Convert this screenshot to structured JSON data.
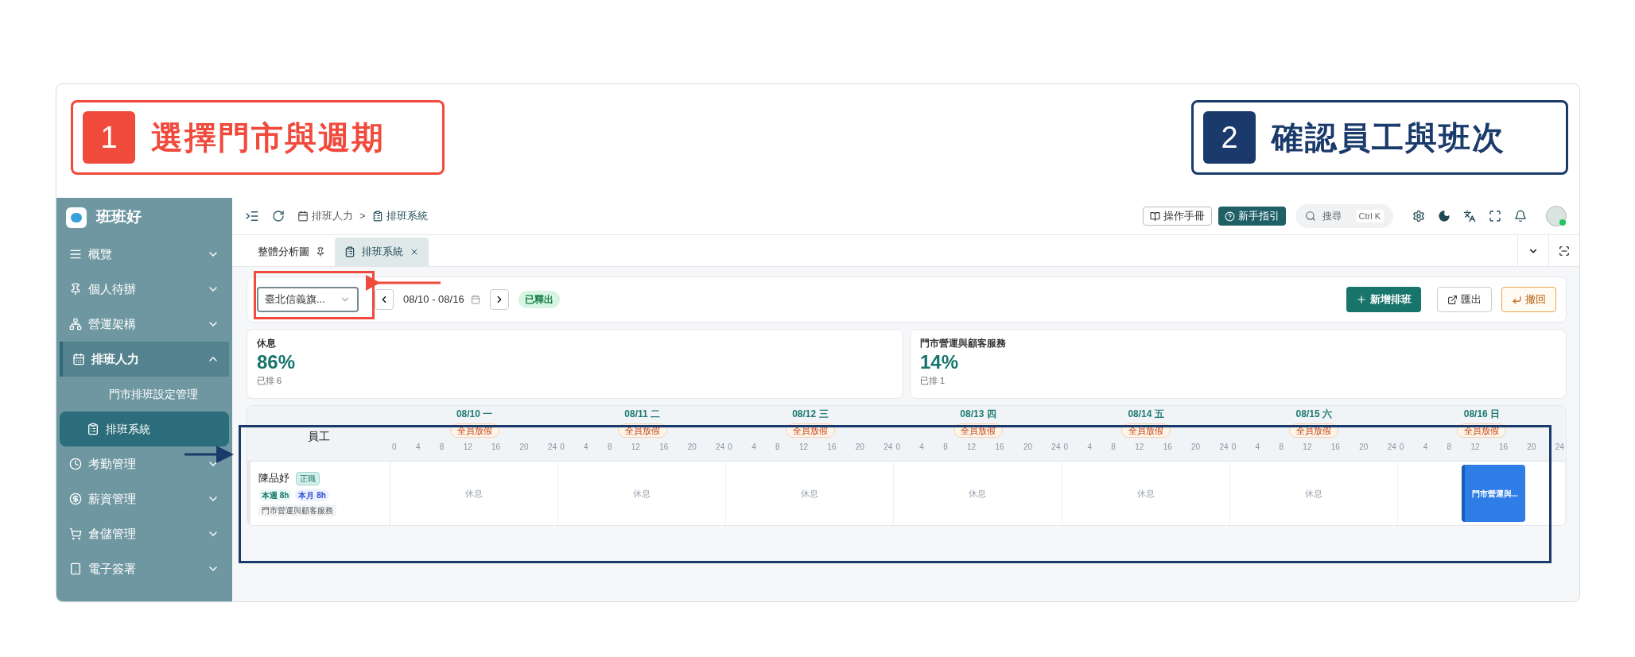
{
  "annotations": [
    {
      "number": "1",
      "label": "選擇門市與週期",
      "color": "#f04a3c"
    },
    {
      "number": "2",
      "label": "確認員工與班次",
      "color": "#1a3a6b"
    }
  ],
  "sidebar": {
    "brand": "班班好",
    "items": [
      {
        "label": "概覽",
        "expanded": false,
        "selected": false
      },
      {
        "label": "個人待辦",
        "expanded": false,
        "selected": false
      },
      {
        "label": "營運架構",
        "expanded": false,
        "selected": false
      },
      {
        "label": "排班人力",
        "expanded": true,
        "selected": true,
        "children": [
          {
            "label": "門市排班設定管理",
            "selected": false
          },
          {
            "label": "排班系統",
            "selected": true
          }
        ]
      },
      {
        "label": "考勤管理",
        "expanded": false,
        "selected": false
      },
      {
        "label": "薪資管理",
        "expanded": false,
        "selected": false
      },
      {
        "label": "倉儲管理",
        "expanded": false,
        "selected": false
      },
      {
        "label": "電子簽署",
        "expanded": false,
        "selected": false
      }
    ]
  },
  "topbar": {
    "breadcrumb": [
      "排班人力",
      "排班系統"
    ],
    "separator": ">",
    "manual_button": "操作手冊",
    "guide_button": "新手指引",
    "search": {
      "placeholder": "搜尋",
      "shortcut": "Ctrl K"
    }
  },
  "tabs": [
    {
      "label": "整體分析圖",
      "selected": false,
      "pinned": true,
      "closable": false
    },
    {
      "label": "排班系統",
      "selected": true,
      "pinned": false,
      "closable": true
    }
  ],
  "toolbar": {
    "store": "臺北信義旗...",
    "week": "08/10 - 08/16",
    "status": "已釋出",
    "add_button": "新增排班",
    "export_button": "匯出",
    "revoke_button": "撤回"
  },
  "stats": [
    {
      "title": "休息",
      "percent": "86%",
      "count": "已排 6"
    },
    {
      "title": "門市營運與顧客服務",
      "percent": "14%",
      "count": "已排 1"
    }
  ],
  "schedule": {
    "employee_header": "員工",
    "days": [
      {
        "date": "08/10 一",
        "badge": "全員放假",
        "ticks": [
          "0",
          "4",
          "8",
          "12",
          "16",
          "20",
          "24"
        ]
      },
      {
        "date": "08/11 二",
        "badge": "全員放假",
        "ticks": [
          "0",
          "4",
          "8",
          "12",
          "16",
          "20",
          "24"
        ]
      },
      {
        "date": "08/12 三",
        "badge": "全員放假",
        "ticks": [
          "0",
          "4",
          "8",
          "12",
          "16",
          "20",
          "24"
        ]
      },
      {
        "date": "08/13 四",
        "badge": "全員放假",
        "ticks": [
          "0",
          "4",
          "8",
          "12",
          "16",
          "20",
          "24"
        ]
      },
      {
        "date": "08/14 五",
        "badge": "全員放假",
        "ticks": [
          "0",
          "4",
          "8",
          "12",
          "16",
          "20",
          "24"
        ]
      },
      {
        "date": "08/15 六",
        "badge": "全員放假",
        "ticks": [
          "0",
          "4",
          "8",
          "12",
          "16",
          "20",
          "24"
        ]
      },
      {
        "date": "08/16 日",
        "badge": "全員放假",
        "ticks": [
          "0",
          "4",
          "8",
          "12",
          "16",
          "20",
          "24"
        ]
      }
    ],
    "employees": [
      {
        "name": "陳品妤",
        "type": "正職",
        "week": "本週 8h",
        "month": "本月 8h",
        "role": "門市營運與顧客服務",
        "cells": [
          {
            "kind": "rest",
            "text": "休息"
          },
          {
            "kind": "rest",
            "text": "休息"
          },
          {
            "kind": "rest",
            "text": "休息"
          },
          {
            "kind": "rest",
            "text": "休息"
          },
          {
            "kind": "rest",
            "text": "休息"
          },
          {
            "kind": "rest",
            "text": "休息"
          },
          {
            "kind": "shift",
            "text": "門市營運與..."
          }
        ]
      }
    ]
  }
}
